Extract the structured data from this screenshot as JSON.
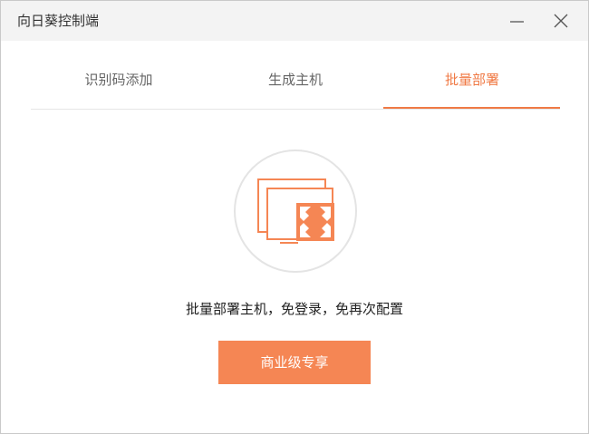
{
  "window": {
    "title": "向日葵控制端",
    "minimize_icon": "minimize-icon",
    "close_icon": "close-icon"
  },
  "tabs": [
    {
      "label": "识别码添加",
      "active": false
    },
    {
      "label": "生成主机",
      "active": false
    },
    {
      "label": "批量部署",
      "active": true
    }
  ],
  "main": {
    "illustration_icon": "batch-deploy-monitors-icon",
    "description": "批量部署主机，免登录，免再次配置",
    "cta_label": "商业级专享"
  },
  "colors": {
    "accent": "#f07a45",
    "button": "#f58654",
    "titlebar": "#f3f3f3"
  }
}
